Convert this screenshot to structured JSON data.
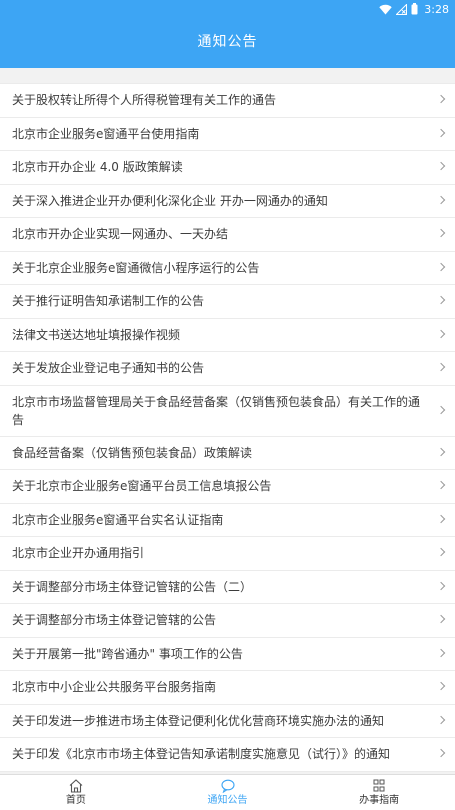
{
  "status_bar": {
    "time": "3:28",
    "icons": [
      "wifi-icon",
      "signal-off-icon",
      "battery-icon"
    ]
  },
  "header": {
    "title": "通知公告"
  },
  "notices": [
    "关于股权转让所得个人所得税管理有关工作的通告",
    "北京市企业服务e窗通平台使用指南",
    "北京市开办企业 4.0 版政策解读",
    "关于深入推进企业开办便利化深化企业 开办一网通办的通知",
    "北京市开办企业实现一网通办、一天办结",
    "关于北京企业服务e窗通微信小程序运行的公告",
    "关于推行证明告知承诺制工作的公告",
    "法律文书送达地址填报操作视频",
    "关于发放企业登记电子通知书的公告",
    "北京市市场监督管理局关于食品经营备案（仅销售预包装食品）有关工作的通告",
    "食品经营备案（仅销售预包装食品）政策解读",
    "关于北京市企业服务e窗通平台员工信息填报公告",
    "北京市企业服务e窗通平台实名认证指南",
    "北京市企业开办通用指引",
    "关于调整部分市场主体登记管辖的公告（二）",
    "关于调整部分市场主体登记管辖的公告",
    "关于开展第一批\"跨省通办\" 事项工作的公告",
    "北京市中小企业公共服务平台服务指南",
    "关于印发进一步推进市场主体登记便利化优化营商环境实施办法的通知",
    "关于印发《北京市市场主体登记告知承诺制度实施意见（试行）》的通知"
  ],
  "tabbar": {
    "items": [
      {
        "label": "首页",
        "icon": "home-icon",
        "active": false
      },
      {
        "label": "通知公告",
        "icon": "message-icon",
        "active": true
      },
      {
        "label": "办事指南",
        "icon": "grid-icon",
        "active": false
      }
    ]
  },
  "colors": {
    "primary": "#3da5f4",
    "background": "#f2f2f2",
    "text": "#3c3c3c",
    "divider": "#ebebeb"
  }
}
